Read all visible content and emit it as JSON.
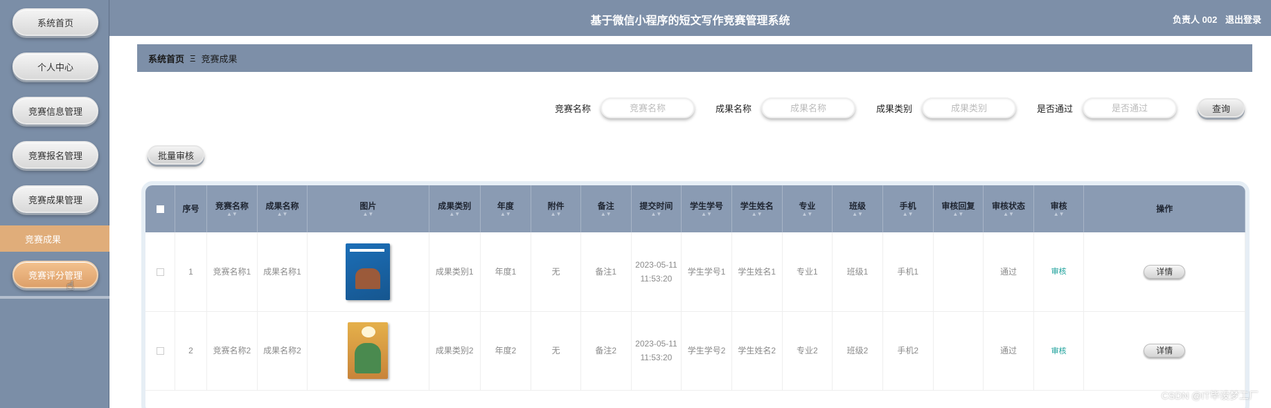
{
  "app": {
    "title": "基于微信小程序的短文写作竞赛管理系统"
  },
  "user": {
    "name": "负责人 002",
    "logout": "退出登录"
  },
  "sidebar": {
    "items": [
      {
        "label": "系统首页"
      },
      {
        "label": "个人中心"
      },
      {
        "label": "竞赛信息管理"
      },
      {
        "label": "竞赛报名管理"
      },
      {
        "label": "竞赛成果管理"
      },
      {
        "label": "竞赛评分管理"
      }
    ],
    "sub_item": "竞赛成果"
  },
  "breadcrumb": {
    "home": "系统首页",
    "separator": "Ξ",
    "current": "竞赛成果"
  },
  "search": {
    "fields": [
      {
        "label": "竞赛名称",
        "placeholder": "竞赛名称"
      },
      {
        "label": "成果名称",
        "placeholder": "成果名称"
      },
      {
        "label": "成果类别",
        "placeholder": "成果类别"
      },
      {
        "label": "是否通过",
        "placeholder": "是否通过"
      }
    ],
    "query_label": "查询"
  },
  "batch_label": "批量审核",
  "table": {
    "headers": [
      "序号",
      "竞赛名称",
      "成果名称",
      "图片",
      "成果类别",
      "年度",
      "附件",
      "备注",
      "提交时间",
      "学生学号",
      "学生姓名",
      "专业",
      "班级",
      "手机",
      "审核回复",
      "审核状态",
      "审核",
      "操作"
    ],
    "rows": [
      {
        "index": "1",
        "contest": "竞赛名称1",
        "result": "成果名称1",
        "category": "成果类别1",
        "year": "年度1",
        "attachment": "无",
        "note": "备注1",
        "time": "2023-05-11 11:53:20",
        "student_no": "学生学号1",
        "student_name": "学生姓名1",
        "major": "专业1",
        "class": "班级1",
        "phone": "手机1",
        "reply": "",
        "status": "通过",
        "review": "审核",
        "action": "详情"
      },
      {
        "index": "2",
        "contest": "竞赛名称2",
        "result": "成果名称2",
        "category": "成果类别2",
        "year": "年度2",
        "attachment": "无",
        "note": "备注2",
        "time": "2023-05-11 11:53:20",
        "student_no": "学生学号2",
        "student_name": "学生姓名2",
        "major": "专业2",
        "class": "班级2",
        "phone": "手机2",
        "reply": "",
        "status": "通过",
        "review": "审核",
        "action": "详情"
      }
    ]
  },
  "watermark": "CSDN @IT毕设梦工厂",
  "colors": {
    "sidebar": "#7b8ea7",
    "active": "#dda06a",
    "header": "#8a9bb3",
    "review_link": "#1aa09a"
  }
}
